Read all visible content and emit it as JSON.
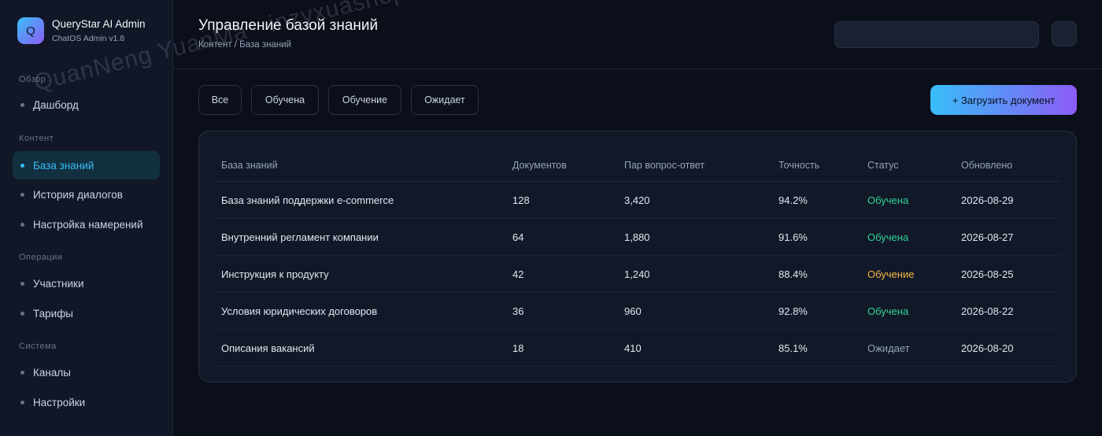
{
  "brand": {
    "logo_letter": "Q",
    "name": "QueryStar AI Admin",
    "version": "ChatOS Admin v1.8"
  },
  "sidebar": {
    "sections": [
      {
        "title": "Обзор",
        "items": [
          {
            "label": "Дашборд",
            "active": false
          }
        ]
      },
      {
        "title": "Контент",
        "items": [
          {
            "label": "База знаний",
            "active": true
          },
          {
            "label": "История диалогов",
            "active": false
          },
          {
            "label": "Настройка намерений",
            "active": false
          }
        ]
      },
      {
        "title": "Операции",
        "items": [
          {
            "label": "Участники",
            "active": false
          },
          {
            "label": "Тарифы",
            "active": false
          }
        ]
      },
      {
        "title": "Система",
        "items": [
          {
            "label": "Каналы",
            "active": false
          },
          {
            "label": "Настройки",
            "active": false
          }
        ]
      }
    ]
  },
  "header": {
    "title": "Управление базой знаний",
    "breadcrumb": "Контент / База знаний",
    "search_value": ""
  },
  "filters": [
    "Все",
    "Обучена",
    "Обучение",
    "Ожидает"
  ],
  "upload_label": "+ Загрузить документ",
  "table": {
    "columns": [
      "База знаний",
      "Документов",
      "Пар вопрос-ответ",
      "Точность",
      "Статус",
      "Обновлено"
    ],
    "rows": [
      {
        "name": "База знаний поддержки e-commerce",
        "docs": "128",
        "qa": "3,420",
        "accuracy": "94.2%",
        "status": "Обучена",
        "status_kind": "trained",
        "updated": "2026-08-29"
      },
      {
        "name": "Внутренний регламент компании",
        "docs": "64",
        "qa": "1,880",
        "accuracy": "91.6%",
        "status": "Обучена",
        "status_kind": "trained",
        "updated": "2026-08-27"
      },
      {
        "name": "Инструкция к продукту",
        "docs": "42",
        "qa": "1,240",
        "accuracy": "88.4%",
        "status": "Обучение",
        "status_kind": "training",
        "updated": "2026-08-25"
      },
      {
        "name": "Условия юридических договоров",
        "docs": "36",
        "qa": "960",
        "accuracy": "92.8%",
        "status": "Обучена",
        "status_kind": "trained",
        "updated": "2026-08-22"
      },
      {
        "name": "Описания вакансий",
        "docs": "18",
        "qa": "410",
        "accuracy": "85.1%",
        "status": "Ожидает",
        "status_kind": "pending",
        "updated": "2026-08-20"
      }
    ]
  },
  "watermark": "QuanNeng YuanMa · inzyxuashop.com",
  "colors": {
    "accent": "#38bdf8",
    "accent_end": "#8b5cf6",
    "trained": "#34d399",
    "training": "#f5b94a",
    "pending": "#94a3b8",
    "background": "#0b0f1a"
  }
}
